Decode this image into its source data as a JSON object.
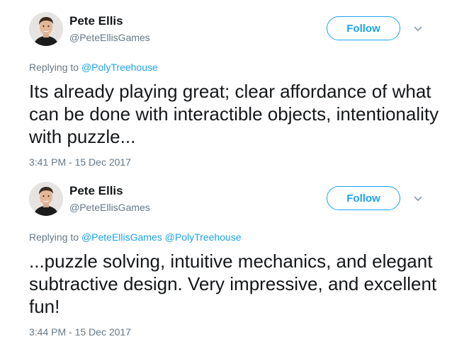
{
  "tweets": [
    {
      "author": {
        "name": "Pete Ellis",
        "handle": "@PeteEllisGames",
        "avatar_icon": "user-avatar"
      },
      "follow_label": "Follow",
      "more_icon": "chevron-down-icon",
      "reply_prefix": "Replying to",
      "reply_to": [
        "@PolyTreehouse"
      ],
      "text": "Its already playing great; clear affordance of what can be done with interactible objects, intentionality with puzzle...",
      "timestamp": "3:41 PM - 15 Dec 2017"
    },
    {
      "author": {
        "name": "Pete Ellis",
        "handle": "@PeteEllisGames",
        "avatar_icon": "user-avatar"
      },
      "follow_label": "Follow",
      "more_icon": "chevron-down-icon",
      "reply_prefix": "Replying to",
      "reply_to": [
        "@PeteEllisGames",
        "@PolyTreehouse"
      ],
      "text": "...puzzle solving, intuitive mechanics, and elegant subtractive design. Very impressive, and excellent fun!",
      "timestamp": "3:44 PM - 15 Dec 2017"
    }
  ],
  "colors": {
    "accent": "#1da1f2",
    "text": "#14171a",
    "muted": "#657786"
  }
}
